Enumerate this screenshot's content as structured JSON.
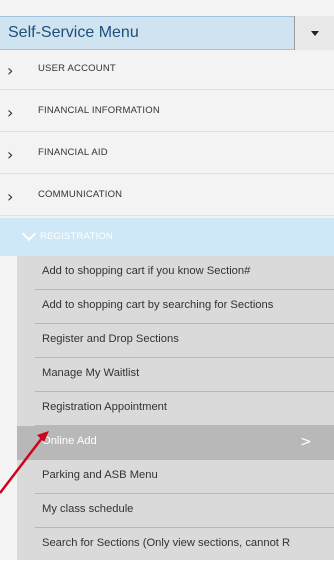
{
  "menu": {
    "title": "Self-Service Menu",
    "dropdown_icon": "caret-down-icon",
    "categories": [
      {
        "label": "USER ACCOUNT",
        "icon": "chevron-right-icon"
      },
      {
        "label": "FINANCIAL INFORMATION",
        "icon": "chevron-right-icon"
      },
      {
        "label": "FINANCIAL AID",
        "icon": "chevron-right-icon"
      },
      {
        "label": "COMMUNICATION",
        "icon": "chevron-right-icon"
      }
    ],
    "registration": {
      "label": "REGISTRATION",
      "icon": "chevron-down-icon",
      "items": [
        {
          "label": "Add to shopping cart if you know Section#"
        },
        {
          "label": "Add to shopping cart by searching for Sections"
        },
        {
          "label": "Register and Drop Sections"
        },
        {
          "label": "Manage My Waitlist"
        },
        {
          "label": "Registration Appointment"
        },
        {
          "label": "Online Add",
          "active": true,
          "chevron": ">"
        },
        {
          "label": "Parking and ASB Menu"
        },
        {
          "label": "My class schedule"
        },
        {
          "label": "Search for Sections (Only view sections, cannot R"
        }
      ]
    }
  },
  "colors": {
    "header_bg": "#cfe3f1",
    "registration_bg": "#cfe8f8",
    "submenu_bg": "#dadada",
    "active_bg": "#b8b8b8",
    "annotation_arrow": "#d0021b"
  }
}
